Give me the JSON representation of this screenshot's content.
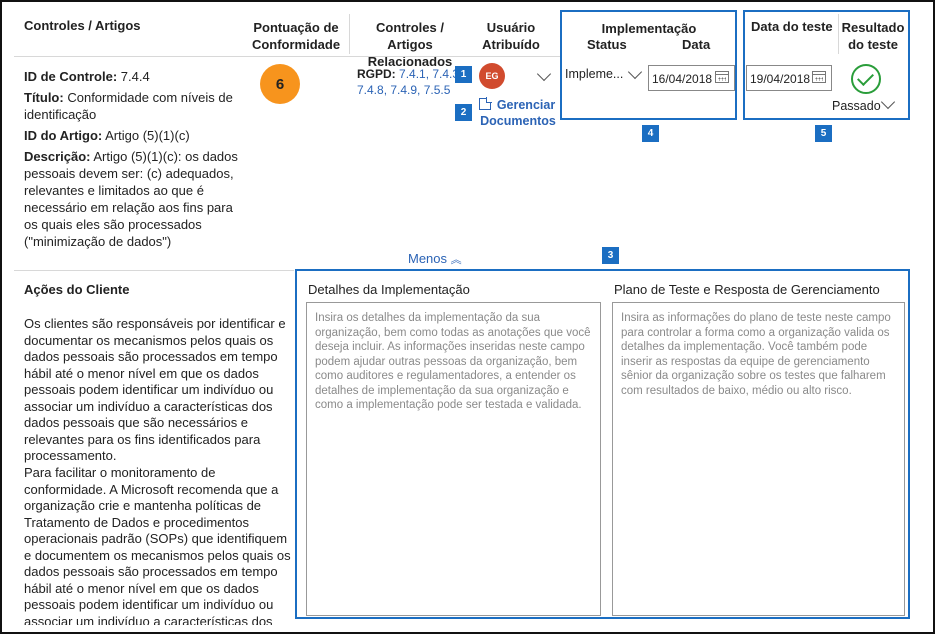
{
  "header": {
    "col_controls": "Controles / Artigos",
    "col_score": "Pontuação de Conformidade",
    "col_related": "Controles / Artigos Relacionados",
    "col_user": "Usuário Atribuído",
    "col_impl": "Implementação",
    "col_impl_status": "Status",
    "col_impl_date": "Data",
    "col_test_date": "Data do teste",
    "col_test_result": "Resultado do teste"
  },
  "control": {
    "id_label": "ID de Controle:",
    "id_value": "7.4.4",
    "title_label": "Título:",
    "title_value": "Conformidade com níveis de identificação",
    "article_label": "ID do Artigo:",
    "article_value": "Artigo (5)(1)(c)",
    "desc_label": "Descrição:",
    "desc_value": "Artigo (5)(1)(c): os dados pessoais devem ser: (c) adequados, relevantes e limitados ao que é necessário em relação aos fins para os quais eles são processados (\"minimização de dados\")"
  },
  "score": "6",
  "related": {
    "label": "RGPD:",
    "links_line1": "7.4.1, 7.4.3",
    "links_line2": "7.4.8, 7.4.9, 7.5.5"
  },
  "user": {
    "initials": "EG"
  },
  "manage_docs": {
    "line1": "Gerenciar",
    "line2": "Documentos"
  },
  "implementation": {
    "status": "Impleme...",
    "date": "16/04/2018"
  },
  "test": {
    "date": "19/04/2018",
    "result": "Passado"
  },
  "less_toggle": "Menos",
  "customer_actions": {
    "title": "Ações do Cliente",
    "para1": "Os clientes são responsáveis por identificar e documentar os mecanismos pelos quais os dados pessoais são processados em tempo hábil até o menor nível em que os dados pessoais podem identificar um indivíduo ou associar um indivíduo a características dos dados pessoais que são necessários e relevantes para os fins identificados para processamento.",
    "para2": "Para facilitar o monitoramento de conformidade. A Microsoft recomenda que a organização crie e mantenha políticas de Tratamento de Dados e procedimentos operacionais padrão (SOPs) que identifiquem e documentem os mecanismos pelos quais os dados pessoais são processados em tempo hábil até o menor nível em que os dados pessoais podem identificar um indivíduo ou associar um indivíduo a características dos"
  },
  "impl_details": {
    "title": "Detalhes da Implementação",
    "placeholder": "Insira os detalhes da implementação da sua organização, bem como todas as anotações que você deseja incluir. As informações inseridas neste campo podem ajudar outras pessoas da organização, bem como auditores e regulamentadores, a entender os detalhes de implementação da sua organização e como a implementação pode ser testada e validada."
  },
  "test_plan": {
    "title": "Plano de Teste e Resposta de Gerenciamento",
    "placeholder": "Insira as informações do plano de teste neste campo para controlar a forma como a organização valida os detalhes da implementação. Você também pode inserir as respostas da equipe de gerenciamento sênior da organização sobre os testes que falharem com resultados de baixo, médio ou alto risco."
  },
  "callouts": [
    "1",
    "2",
    "3",
    "4",
    "5"
  ],
  "colors": {
    "accent_blue": "#1b6ec2",
    "link_blue": "#2b63b5",
    "score_orange": "#f7941d",
    "avatar_red": "#d14b2e",
    "pass_green": "#2a9d3a"
  }
}
